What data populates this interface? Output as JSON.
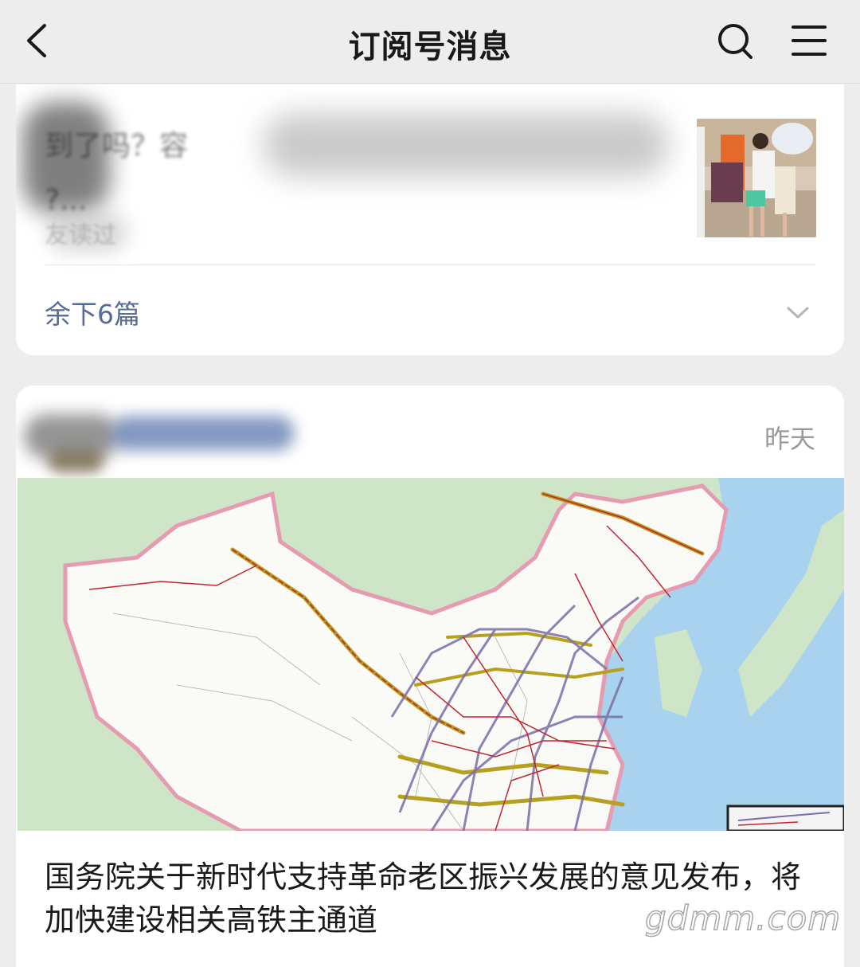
{
  "header": {
    "title": "订阅号消息",
    "back_icon": "chevron-left-icon",
    "search_icon": "search-icon",
    "menu_icon": "menu-icon"
  },
  "card1": {
    "title_line1": "到了吗？容",
    "title_line2": "?...",
    "meta": "友读过",
    "remaining_label": "余下6篇",
    "expand_icon": "chevron-down-icon"
  },
  "card2": {
    "date": "昨天",
    "article_title": "国务院关于新时代支持革命老区振兴发展的意见发布，将加快建设相关高铁主通道"
  },
  "watermark": "gdmm.com",
  "colors": {
    "background": "#ededed",
    "card": "#ffffff",
    "link": "#576b95",
    "map_sea": "#a9d2ee",
    "map_land": "#cfe5c8",
    "rail_line": "#c0262e",
    "rail_corridor": "#b7a020"
  }
}
